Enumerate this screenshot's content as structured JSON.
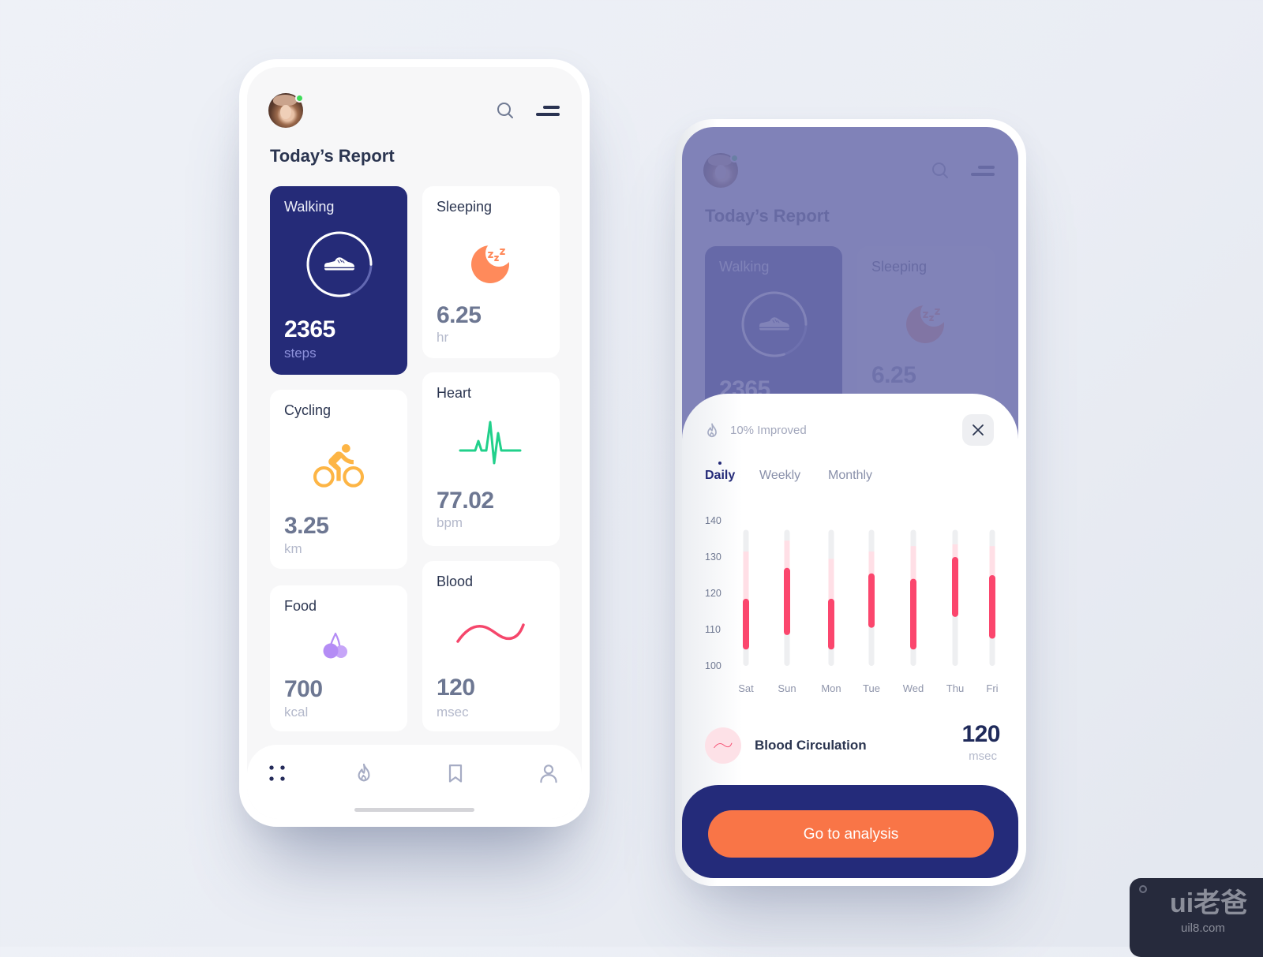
{
  "header": {
    "title": "Today’s Report",
    "avatar": "user-avatar",
    "status": "online",
    "search_icon": "search-icon",
    "menu_icon": "menu-icon"
  },
  "cards": {
    "walking": {
      "title": "Walking",
      "value": "2365",
      "unit": "steps",
      "icon": "sneaker-icon",
      "progress": 0.8
    },
    "sleeping": {
      "title": "Sleeping",
      "value": "6.25",
      "unit": "hr",
      "icon": "moon-sleep-icon"
    },
    "cycling": {
      "title": "Cycling",
      "value": "3.25",
      "unit": "km",
      "icon": "bicycle-icon"
    },
    "heart": {
      "title": "Heart",
      "value": "77.02",
      "unit": "bpm",
      "icon": "heartbeat-icon"
    },
    "food": {
      "title": "Food",
      "value": "700",
      "unit": "kcal",
      "icon": "cherry-icon"
    },
    "blood": {
      "title": "Blood",
      "value": "120",
      "unit": "msec",
      "icon": "wave-icon"
    }
  },
  "nav": {
    "items": [
      {
        "name": "dashboard",
        "icon": "grid-icon",
        "active": true
      },
      {
        "name": "activity",
        "icon": "flame-icon",
        "active": false
      },
      {
        "name": "saved",
        "icon": "bookmark-icon",
        "active": false
      },
      {
        "name": "profile",
        "icon": "user-icon",
        "active": false
      }
    ]
  },
  "detail": {
    "improvement": "10% Improved",
    "tabs": [
      {
        "label": "Daily",
        "active": true
      },
      {
        "label": "Weekly",
        "active": false
      },
      {
        "label": "Monthly",
        "active": false
      }
    ],
    "metric": {
      "label": "Blood Circulation",
      "value": "120",
      "unit": "msec"
    },
    "cta": "Go to analysis"
  },
  "colors": {
    "navy": "#252b78",
    "footer": "#242b7a",
    "orange": "#f97547",
    "status_online": "#3fdc5a",
    "moon": "#ff8a5b",
    "bike": "#fdb545",
    "heart": "#21d08b",
    "cherry": "#b48cf5",
    "blood": "#f5466b",
    "bar_range": "#fb466d",
    "bar_band": "#ffdfe6",
    "bar_track": "#eeeff1"
  },
  "watermark": {
    "logo": "ui老爸",
    "url": "uil8.com"
  },
  "chart_data": {
    "type": "bar",
    "subtype": "range",
    "title": "",
    "xlabel": "",
    "ylabel": "",
    "categories": [
      "Sat",
      "Sun",
      "Mon",
      "Tue",
      "Wed",
      "Thu",
      "Fri"
    ],
    "yticks": [
      140,
      130,
      120,
      110,
      100
    ],
    "ylim": [
      100,
      140
    ],
    "track_range": [
      100,
      137.5
    ],
    "series": [
      {
        "name": "range_low",
        "values": [
          104.5,
          108.5,
          104.5,
          110.5,
          104.5,
          113.5,
          107.5
        ]
      },
      {
        "name": "range_high",
        "values": [
          118.5,
          127,
          118.5,
          125.5,
          124,
          130,
          125
        ]
      },
      {
        "name": "upper_band",
        "values": [
          131.5,
          134.5,
          129.5,
          131.5,
          133,
          133.5,
          133
        ]
      }
    ],
    "grid": false,
    "legend": "none"
  }
}
